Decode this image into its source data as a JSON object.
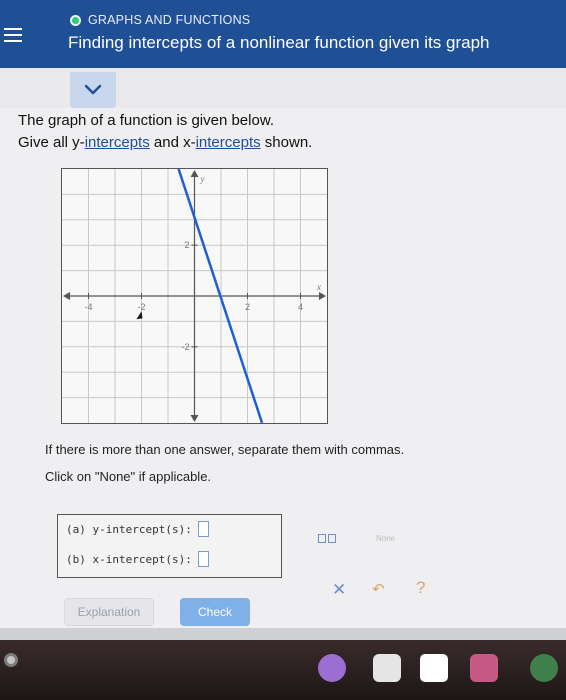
{
  "header": {
    "topic": "GRAPHS AND FUNCTIONS",
    "title": "Finding intercepts of a nonlinear function given its graph"
  },
  "prompt": {
    "line1": "The graph of a function is given below.",
    "line2_prefix": "Give all y-",
    "line2_link1": "intercepts",
    "line2_mid": " and x-",
    "line2_link2": "intercepts",
    "line2_suffix": " shown."
  },
  "graph": {
    "axis_x_label": "x",
    "axis_y_label": "y",
    "x_ticks": [
      {
        "value": -4,
        "label": "-4"
      },
      {
        "value": -2,
        "label": "-2"
      },
      {
        "value": 2,
        "label": "2"
      },
      {
        "value": 4,
        "label": "4"
      }
    ],
    "y_ticks": [
      {
        "value": 2,
        "label": "2"
      },
      {
        "value": -2,
        "label": "-2"
      }
    ],
    "xlim": [
      -5,
      5
    ],
    "ylim": [
      -5,
      5
    ],
    "line_color": "#1f5fd1",
    "line_points": [
      {
        "x": -0.6,
        "y": 5
      },
      {
        "x": 2.55,
        "y": -5
      }
    ]
  },
  "instructions": {
    "line1": "If there is more than one answer, separate them with commas.",
    "line2": "Click on \"None\" if applicable."
  },
  "answers": {
    "a_label": "(a)  y-intercept(s):",
    "b_label": "(b)  x-intercept(s):",
    "a_value": "",
    "b_value": ""
  },
  "tools": {
    "none_label": "None",
    "clear_icon": "x-icon",
    "undo_icon": "undo-icon",
    "help_icon": "help-icon"
  },
  "buttons": {
    "explanation": "Explanation",
    "check": "Check"
  },
  "colors": {
    "header_bg": "#1f4f94",
    "accent": "#1f5fd1",
    "check_button": "#7fb0e8"
  }
}
